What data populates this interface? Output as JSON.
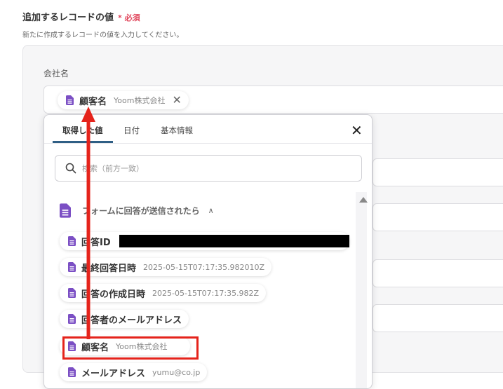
{
  "section": {
    "title": "追加するレコードの値",
    "required": "* 必須",
    "description": "新たに作成するレコードの値を入力してください。"
  },
  "field": {
    "label": "会社名",
    "chip": {
      "name": "顧客名",
      "value": "Yoom株式会社",
      "close": "✕"
    }
  },
  "popup": {
    "tabs": [
      {
        "label": "取得した値",
        "active": true
      },
      {
        "label": "日付",
        "active": false
      },
      {
        "label": "基本情報",
        "active": false
      }
    ],
    "close": "✕",
    "search_placeholder": "検索（前方一致）",
    "group": {
      "label": "フォームに回答が送信されたら",
      "chevron": "∧"
    },
    "items": [
      {
        "name": "回答ID",
        "value": "",
        "redacted": true
      },
      {
        "name": "最終回答日時",
        "value": "2025-05-15T07:17:35.982010Z"
      },
      {
        "name": "回答の作成日時",
        "value": "2025-05-15T07:17:35.982Z"
      },
      {
        "name": "回答者のメールアドレス",
        "value": ""
      },
      {
        "name": "顧客名",
        "value": "Yoom株式会社",
        "highlighted": true
      },
      {
        "name": "メールアドレス",
        "value": "yumu@co.jp"
      }
    ]
  },
  "colors": {
    "accent": "#2f5f85",
    "doc_icon": "#7b4fc4",
    "highlight": "#e5231b",
    "required": "#e0455b"
  }
}
